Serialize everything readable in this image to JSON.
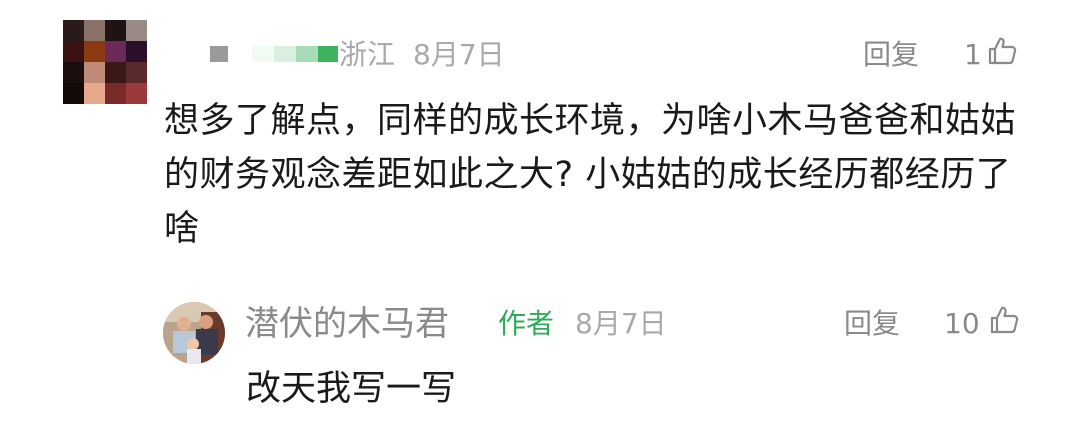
{
  "comment": {
    "location": "浙江",
    "date": "8月7日",
    "reply_label": "回复",
    "like_count": "1",
    "text": "想多了解点，同样的成长环境，为啥小木马爸爸和姑姑的财务观念差距如此之大? 小姑姑的成长经历都经历了啥",
    "avatar_icon": "pixelated-avatar-icon"
  },
  "reply": {
    "username": "潜伏的木马君",
    "author_badge": "作者",
    "date": "8月7日",
    "reply_label": "回复",
    "like_count": "10",
    "text": "改天我写一写",
    "avatar_icon": "family-photo-avatar-icon"
  },
  "colors": {
    "author_badge": "#2faa5a",
    "meta": "#a9a9a9",
    "body_text": "#1a1a1a"
  }
}
